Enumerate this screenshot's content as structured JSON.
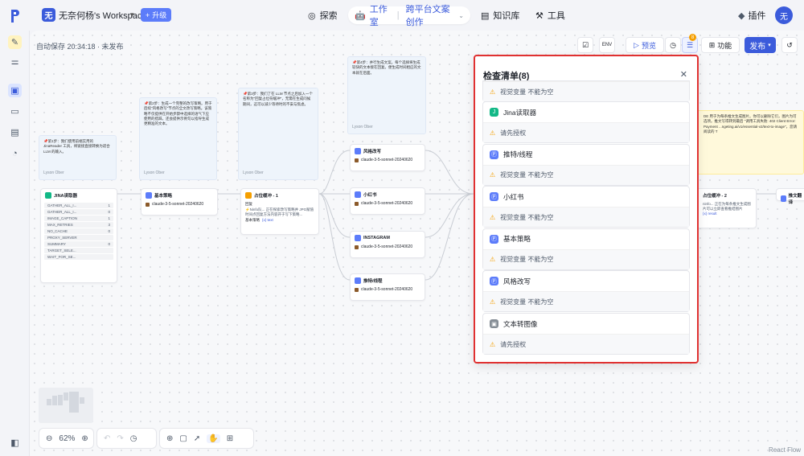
{
  "header": {
    "workspace_initial": "无",
    "workspace_name": "无奈何杨's Workspace",
    "upgrade_label": "升级",
    "nav": {
      "explore": "探索",
      "studio": "工作室",
      "project": "跨平台文案创作",
      "knowledge": "知识库",
      "tools": "工具"
    },
    "plugin_label": "插件",
    "user_initial": "无"
  },
  "toolbar": {
    "autosave": "自动保存 20:34:18 · 未发布",
    "preview_label": "预览",
    "feature_label": "功能",
    "publish_label": "发布",
    "check_badge": "8"
  },
  "panel": {
    "title": "检查清单(8)",
    "items": [
      {
        "name": "",
        "icon": "llm-icon",
        "warning": "视觉变量 不能为空"
      },
      {
        "name": "Jina读取器",
        "icon": "jina-icon",
        "warning": "请先授权"
      },
      {
        "name": "推特/线程",
        "icon": "llm-icon",
        "warning": "视觉变量 不能为空"
      },
      {
        "name": "小红书",
        "icon": "llm-icon",
        "warning": "视觉变量 不能为空"
      },
      {
        "name": "基本策略",
        "icon": "llm-icon",
        "warning": "视觉变量 不能为空"
      },
      {
        "name": "风格改写",
        "icon": "llm-icon",
        "warning": "视觉变量 不能为空"
      },
      {
        "name": "文本转图像",
        "icon": "image-icon",
        "warning": "请先授权"
      }
    ]
  },
  "canvas": {
    "notes": [
      {
        "text": "📌第1步：我们使用前端实用的 JinaReader 工具，将链接直接转换为适合 LLM 的输入。",
        "author": "Lyson Ober"
      },
      {
        "text": "📌第2步：生成一个完整的改写策略。用于后续\"风格改写\"节点的全文改写策略。该策略不仅提供在开始步骤中选择的语气下应使用的措辞，还会提供示例句以指导生成更精准的文本。",
        "author": "Lyson Ober"
      },
      {
        "text": "📌第3步：我们了在 LLM 节点之后加入一个名称为\"回复占位符缓冲\"，无需在生成问候期间，这可以减少等待时的不安与焦虑。",
        "author": "Lyson Ober"
      },
      {
        "text": "📌第4步：并行生成文案。每个选择将生成较快的文本接在回复。便生成时间相应的文本就在后面。",
        "author": "Lyson Ober"
      }
    ],
    "jina_node": {
      "title": "JINA读取器",
      "params": [
        {
          "k": "GATHER_ALL_I...",
          "v": "1"
        },
        {
          "k": "GATHER_ALL_I...",
          "v": "0"
        },
        {
          "k": "IMAGE_CAPTION",
          "v": "1"
        },
        {
          "k": "MAX_RETRIES",
          "v": "3"
        },
        {
          "k": "NO_CACHE",
          "v": "0"
        },
        {
          "k": "PROXY_SERVER",
          "v": ""
        },
        {
          "k": "SUMMARY",
          "v": "0"
        },
        {
          "k": "TARGET_SELE...",
          "v": ""
        },
        {
          "k": "WAIT_FOR_SE...",
          "v": ""
        }
      ]
    },
    "model": "claude-3-5-sonnet-20240620",
    "strategy_node": "基本策略",
    "placeholder_node": {
      "title": "占位缓冲 - 1",
      "reply_label": "回复",
      "reply_text": "⚡️Ninfo队... 正在探索改写策略并 JPG赋值时间点回复方法内容开于写下策略...",
      "var_label": "基本策略",
      "var_type": "{x} text"
    },
    "branches": [
      "风格改写",
      "小红书",
      "INSTAGRAM",
      "推特/线程"
    ],
    "right_node": "占位缓冲 - 2",
    "right_node_text": "ninfo... 正在为每条推文生成图片可以立即查看推结图片",
    "right_node_var": "{x} result",
    "final_node": "推文翻译",
    "right_note": "DE 用于为每条推文生成图片。你可以删除它们，图片为可选项。推文写得转到最后 \"调用工具失败: 402 Client Error: Payment ...ngeting.ai/v1/essential-v2/text-to-image\"，您请阅读的 T",
    "zoom": "62%",
    "react_flow": "React Flow"
  }
}
